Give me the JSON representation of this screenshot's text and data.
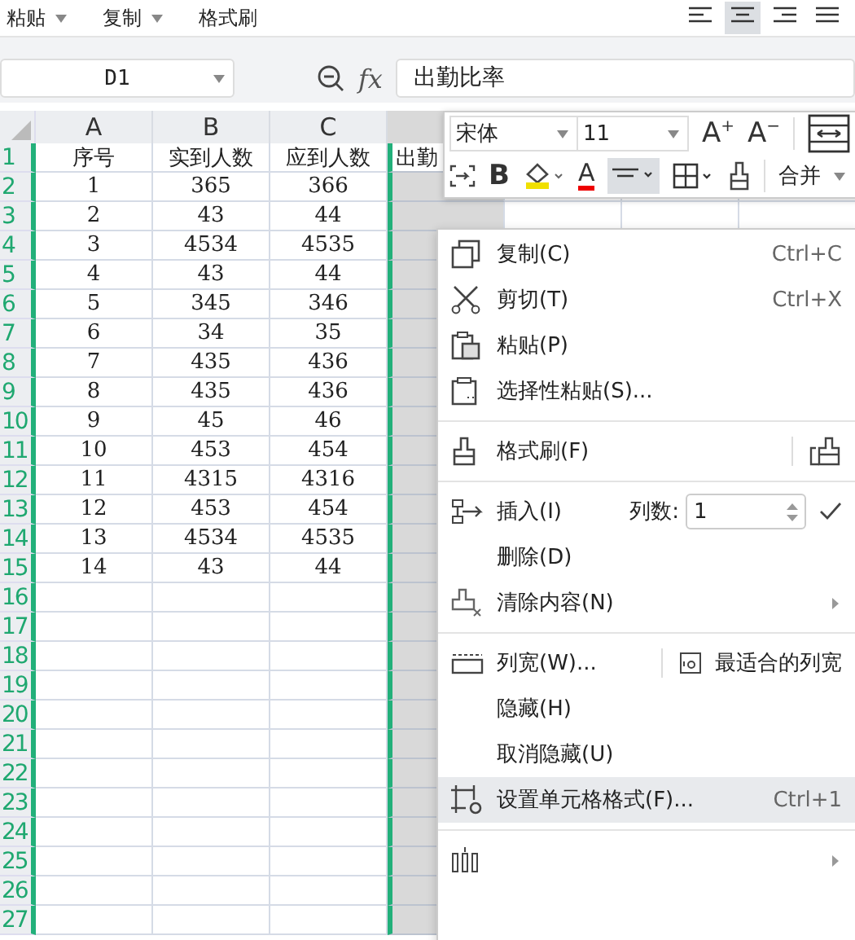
{
  "ribbon": {
    "labels": [
      "粘贴",
      "复制",
      "格式刷"
    ],
    "alignments": [
      {
        "selected": false
      },
      {
        "selected": true
      },
      {
        "selected": false
      },
      {
        "selected": false
      }
    ]
  },
  "formula_bar": {
    "name_box": "D1",
    "fx": "fx",
    "value": "出勤比率"
  },
  "sheet": {
    "columns": [
      "A",
      "B",
      "C"
    ],
    "rows": [
      {
        "number": "1",
        "cells": [
          "序号",
          "实到人数",
          "应到人数",
          "出勤"
        ]
      },
      {
        "number": "2",
        "cells": [
          "1",
          "365",
          "366"
        ]
      },
      {
        "number": "3",
        "cells": [
          "2",
          "43",
          "44"
        ]
      },
      {
        "number": "4",
        "cells": [
          "3",
          "4534",
          "4535"
        ]
      },
      {
        "number": "5",
        "cells": [
          "4",
          "43",
          "44"
        ]
      },
      {
        "number": "6",
        "cells": [
          "5",
          "345",
          "346"
        ]
      },
      {
        "number": "7",
        "cells": [
          "6",
          "34",
          "35"
        ]
      },
      {
        "number": "8",
        "cells": [
          "7",
          "435",
          "436"
        ]
      },
      {
        "number": "9",
        "cells": [
          "8",
          "435",
          "436"
        ]
      },
      {
        "number": "10",
        "cells": [
          "9",
          "45",
          "46"
        ]
      },
      {
        "number": "11",
        "cells": [
          "10",
          "453",
          "454"
        ]
      },
      {
        "number": "12",
        "cells": [
          "11",
          "4315",
          "4316"
        ]
      },
      {
        "number": "13",
        "cells": [
          "12",
          "453",
          "454"
        ]
      },
      {
        "number": "14",
        "cells": [
          "13",
          "4534",
          "4535"
        ]
      },
      {
        "number": "15",
        "cells": [
          "14",
          "43",
          "44"
        ]
      },
      {
        "number": "16",
        "cells": []
      },
      {
        "number": "17",
        "cells": []
      },
      {
        "number": "18",
        "cells": []
      },
      {
        "number": "19",
        "cells": []
      },
      {
        "number": "20",
        "cells": []
      },
      {
        "number": "21",
        "cells": []
      },
      {
        "number": "22",
        "cells": []
      },
      {
        "number": "23",
        "cells": []
      },
      {
        "number": "24",
        "cells": []
      },
      {
        "number": "25",
        "cells": []
      },
      {
        "number": "26",
        "cells": []
      },
      {
        "number": "27",
        "cells": []
      }
    ]
  },
  "mini_toolbar": {
    "font": "宋体",
    "size": "11",
    "grow": "A$^{+}$",
    "shrink": "A$^{−}$",
    "bold": "B",
    "font_color": "A",
    "merge": "合并",
    "align_selected": true
  },
  "context_menu": [
    {
      "kind": "item",
      "label": "复制(C)",
      "shortcut": "Ctrl+C",
      "selected": false
    },
    {
      "kind": "item",
      "label": "剪切(T)",
      "shortcut": "Ctrl+X",
      "selected": false
    },
    {
      "kind": "item",
      "label": "粘贴(P)",
      "selected": false
    },
    {
      "kind": "item",
      "label": "选择性粘贴(S)...",
      "selected": false
    },
    {
      "kind": "separator"
    },
    {
      "kind": "painter",
      "label": "格式刷(F)",
      "selected": false
    },
    {
      "kind": "separator"
    },
    {
      "kind": "insert",
      "label": "插入(I)",
      "count_label": "列数:",
      "count": "1",
      "selected": false
    },
    {
      "kind": "item",
      "label": "删除(D)",
      "selected": false
    },
    {
      "kind": "submenu",
      "label": "清除内容(N)",
      "selected": false
    },
    {
      "kind": "separator"
    },
    {
      "kind": "width",
      "label": "列宽(W)...",
      "side_label": "最适合的列宽",
      "selected": false
    },
    {
      "kind": "item",
      "label": "隐藏(H)",
      "selected": false
    },
    {
      "kind": "item",
      "label": "取消隐藏(U)",
      "selected": false
    },
    {
      "kind": "item",
      "label": "设置单元格格式(F)...",
      "shortcut": "Ctrl+1",
      "selected": true
    },
    {
      "kind": "separator"
    },
    {
      "kind": "submenu",
      "selected": false
    }
  ]
}
